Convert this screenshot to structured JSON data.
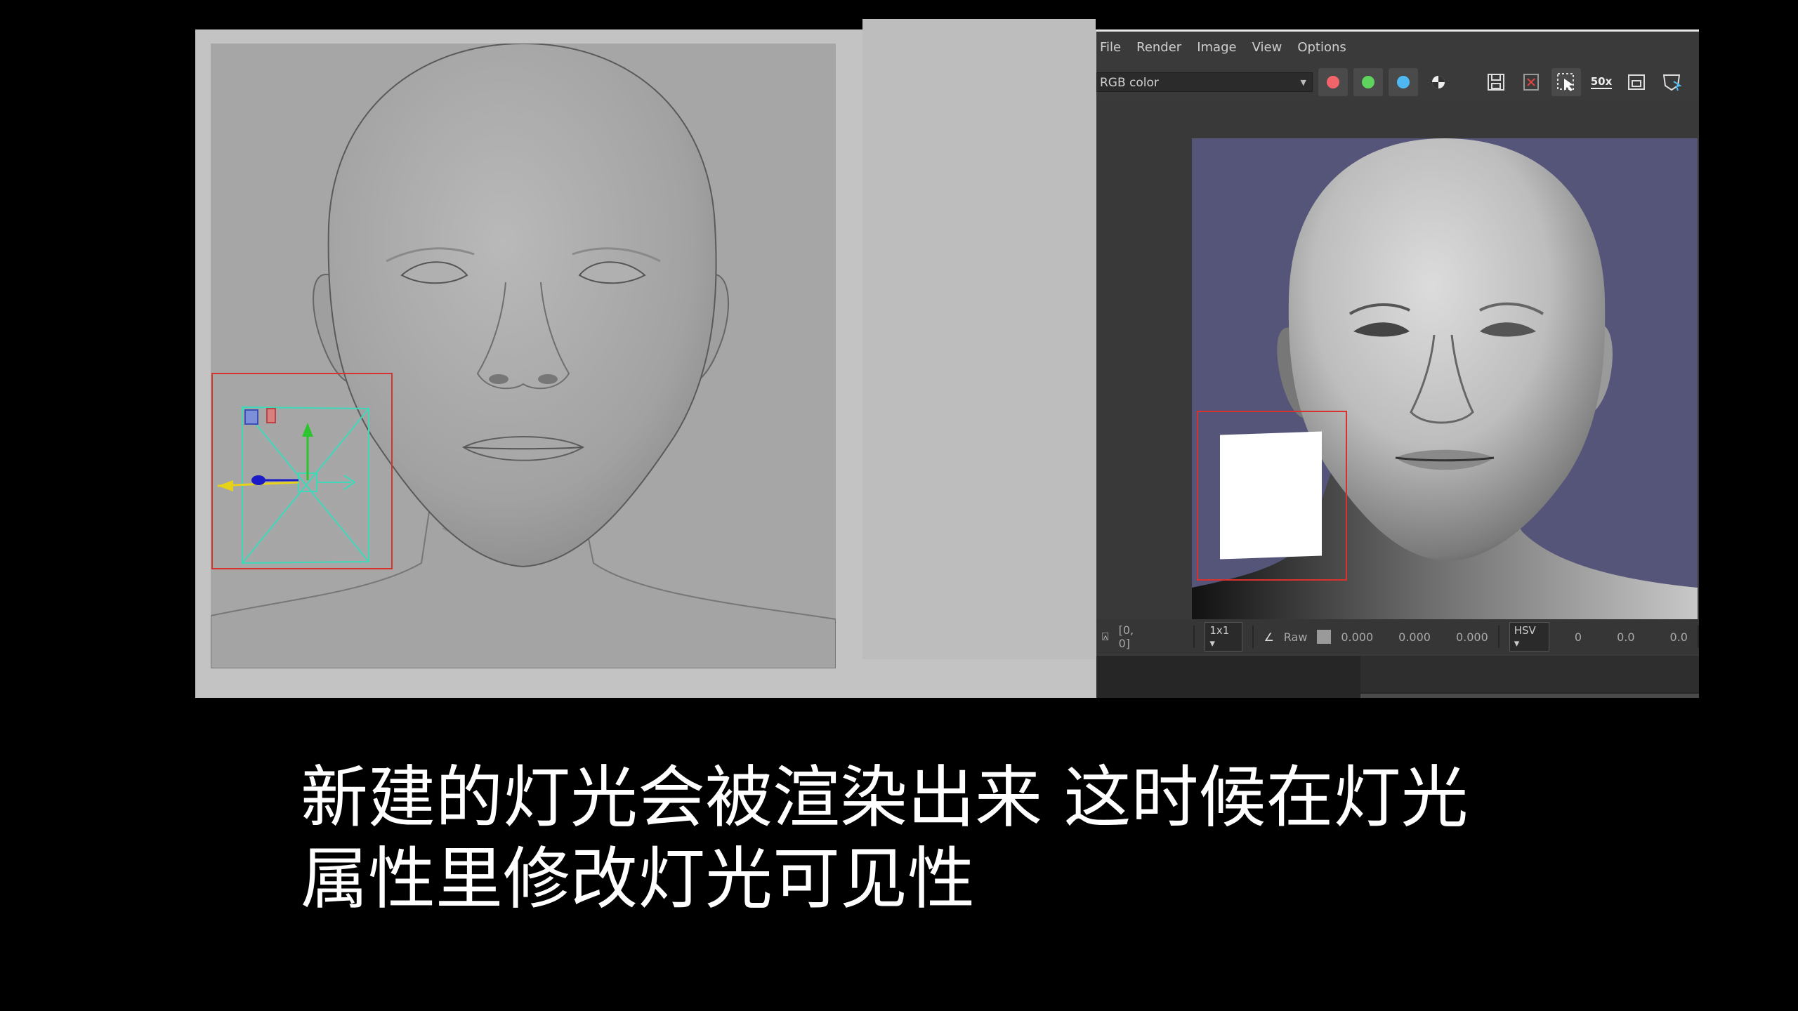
{
  "render_view": {
    "menu": [
      "File",
      "Render",
      "Image",
      "View",
      "Options"
    ],
    "channel_select": "RGB color",
    "toolbar_icons": [
      "red-channel-icon",
      "green-channel-icon",
      "blue-channel-icon",
      "alpha-channel-icon",
      "save-icon",
      "remove-image-icon",
      "region-select-icon",
      "zoom-50-icon",
      "frame-icon",
      "snapshot-icon"
    ],
    "zoom_label": "50x",
    "status": {
      "coords": "[0, 0]",
      "scale": "1x1",
      "raw_label": "Raw",
      "rgb_values": [
        "0.000",
        "0.000",
        "0.000"
      ],
      "color_space": "HSV",
      "hsv_values": [
        "0",
        "0.0",
        "0.0"
      ]
    }
  },
  "subtitle": {
    "line1": "新建的灯光会被渲染出来 这时候在灯光",
    "line2": "属性里修改灯光可见性"
  },
  "colors": {
    "selection": "#d8322f",
    "render_bg": "#55557a",
    "viewport_bg": "#a6a6a6"
  }
}
